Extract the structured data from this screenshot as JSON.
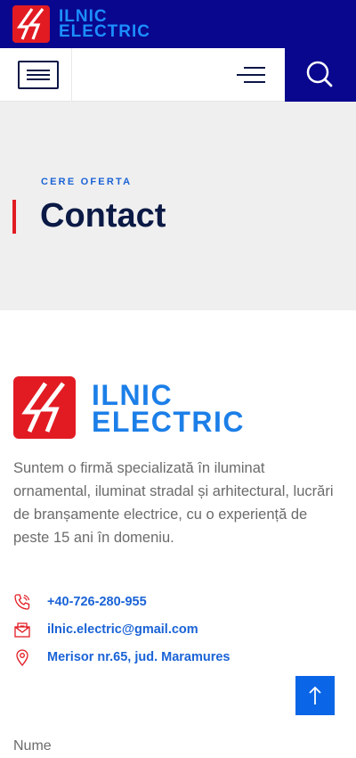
{
  "brand": {
    "name_line1": "ILNIC",
    "name_line2": "ELECTRIC",
    "logo_icon": "lightning-bolt-logo"
  },
  "nav": {
    "keyboard_icon": "keyboard-icon",
    "menu_icon": "hamburger-menu-icon",
    "search_icon": "search-icon"
  },
  "hero": {
    "subtitle": "CERE OFERTA",
    "title": "Contact"
  },
  "about": {
    "text": "Suntem o firmă specializată în iluminat ornamental, iluminat stradal și arhitectural, lucrări de branșamente electrice, cu o experiență de peste 15 ani în domeniu."
  },
  "contact": {
    "phone": "+40-726-280-955",
    "email": "ilnic.electric@gmail.com",
    "address": "Merisor nr.65, jud. Maramures"
  },
  "form": {
    "name_label": "Nume"
  },
  "colors": {
    "primary_dark": "#08078d",
    "accent_red": "#e21b23",
    "accent_blue": "#1a63d6"
  }
}
